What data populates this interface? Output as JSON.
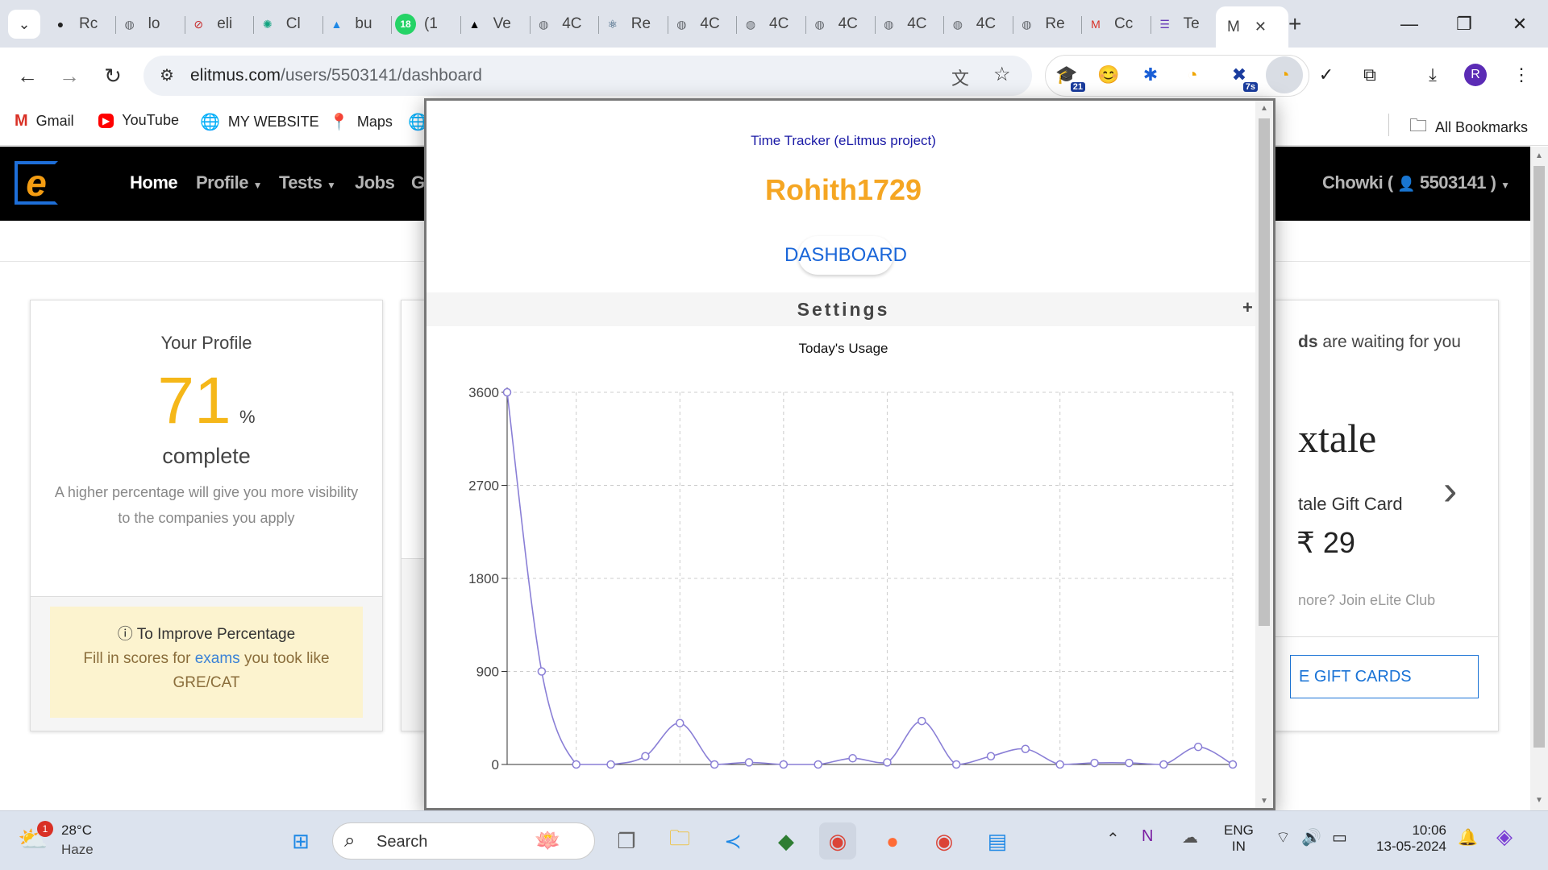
{
  "browser": {
    "tabs": [
      {
        "label": "Rc",
        "icon": "github-icon"
      },
      {
        "label": "lo",
        "icon": "globe-icon"
      },
      {
        "label": "eli",
        "icon": "blocked-icon"
      },
      {
        "label": "Cl",
        "icon": "chatgpt-icon"
      },
      {
        "label": "bu",
        "icon": "drive-icon"
      },
      {
        "label": "(1",
        "icon": "whatsapp-icon",
        "badge": "18"
      },
      {
        "label": "Ve",
        "icon": "vercel-icon"
      },
      {
        "label": "4C",
        "icon": "globe-icon"
      },
      {
        "label": "Re",
        "icon": "react-icon"
      },
      {
        "label": "4C",
        "icon": "globe-icon"
      },
      {
        "label": "4C",
        "icon": "globe-icon"
      },
      {
        "label": "4C",
        "icon": "globe-icon"
      },
      {
        "label": "4C",
        "icon": "globe-icon"
      },
      {
        "label": "4C",
        "icon": "globe-icon"
      },
      {
        "label": "Re",
        "icon": "globe-icon"
      },
      {
        "label": "Cc",
        "icon": "gmail-icon"
      },
      {
        "label": "Te",
        "icon": "forms-icon"
      }
    ],
    "active_tab": {
      "label": "M",
      "close": "✕"
    },
    "new_tab": "+",
    "url_domain": "elitmus.com",
    "url_path": "/users/5503141/dashboard",
    "extension_badges": {
      "ext1": "21",
      "ext2": "7s"
    },
    "profile_initial": "R"
  },
  "bookmarks": {
    "items": [
      {
        "label": "Gmail",
        "icon": "gmail-icon"
      },
      {
        "label": "YouTube",
        "icon": "youtube-icon"
      },
      {
        "label": "MY WEBSITE",
        "icon": "globe-icon"
      },
      {
        "label": "Maps",
        "icon": "maps-pin-icon"
      }
    ],
    "all_bookmarks": "All Bookmarks"
  },
  "site": {
    "logo": "e",
    "nav": {
      "home": "Home",
      "profile": "Profile",
      "tests": "Tests",
      "jobs": "Jobs",
      "g": "G",
      "user": "Chowki ( ",
      "user_id": "5503141",
      "user_close": " )"
    },
    "profile_card": {
      "title": "Your Profile",
      "percent": "71",
      "percent_sign": "%",
      "complete": "complete",
      "desc": "A higher percentage will give you more visibility to the companies you apply",
      "improve_title": "To Improve Percentage",
      "improve_text_1": "Fill in scores for ",
      "improve_link": "exams",
      "improve_text_2": " you took like GRE/CAT"
    },
    "rewards_card": {
      "waiting_bold": "ds",
      "waiting_rest": " are waiting for you",
      "brand": "xtale",
      "gift_title": "tale Gift Card",
      "price": "₹ 29",
      "join": "nore? Join eLite Club",
      "button": "E GIFT CARDS"
    }
  },
  "popup": {
    "header": "Time Tracker (eLitmus project)",
    "username": "Rohith1729",
    "dashboard_btn": "DASHBOARD",
    "settings": "Settings",
    "settings_toggle": "+",
    "chart_title": "Today's Usage"
  },
  "chart_data": {
    "type": "line",
    "title": "Today's Usage",
    "xlabel": "",
    "ylabel": "",
    "ylim": [
      0,
      3600
    ],
    "yticks": [
      0,
      900,
      1800,
      2700,
      3600
    ],
    "color": "#8a7fd6",
    "grid": true,
    "series": [
      {
        "values": [
          3600,
          900,
          0,
          0,
          80,
          400,
          0,
          20,
          0,
          0,
          60,
          20,
          420,
          0,
          80,
          150,
          0,
          15,
          15,
          0,
          170,
          0
        ]
      }
    ]
  },
  "taskbar": {
    "weather_temp": "28°C",
    "weather_desc": "Haze",
    "weather_badge": "1",
    "search_placeholder": "Search",
    "lang_1": "ENG",
    "lang_2": "IN",
    "time": "10:06",
    "date": "13-05-2024"
  }
}
